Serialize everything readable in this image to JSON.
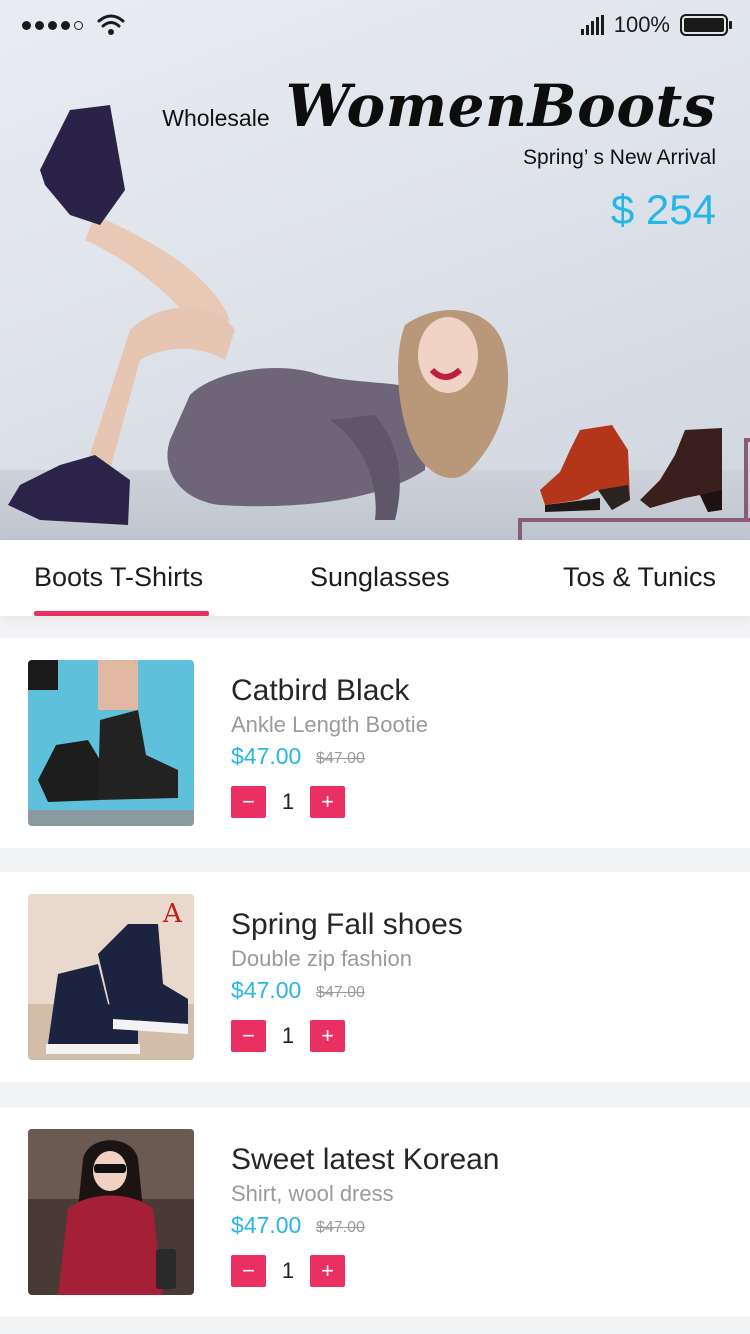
{
  "status_bar": {
    "battery_percent": "100%",
    "battery_level": 1.0,
    "signal_icon": "signal-dots-icon",
    "wifi_icon": "wifi-icon",
    "cell_icon": "cellular-bars-icon",
    "battery_icon": "battery-icon"
  },
  "hero": {
    "prefix": "Wholesale",
    "title": "WomenBoots",
    "subtitle": "Spring’ s New Arrival",
    "price": "$ 254",
    "accent_color": "#25b6e8"
  },
  "tabs": [
    {
      "label": "Boots T-Shirts",
      "active": true
    },
    {
      "label": "Sunglasses",
      "active": false
    },
    {
      "label": "Tos & Tunics",
      "active": false
    }
  ],
  "products": [
    {
      "name": "Catbird Black",
      "description": "Ankle Length Bootie",
      "price": "$47.00",
      "old_price": "$47.00",
      "quantity": "1",
      "minus": "−",
      "plus": "+"
    },
    {
      "name": "Spring Fall shoes",
      "description": "Double zip fashion",
      "price": "$47.00",
      "old_price": "$47.00",
      "quantity": "1",
      "minus": "−",
      "plus": "+"
    },
    {
      "name": "Sweet latest Korean",
      "description": "Shirt, wool dress",
      "price": "$47.00",
      "old_price": "$47.00",
      "quantity": "1",
      "minus": "−",
      "plus": "+"
    }
  ],
  "colors": {
    "accent_pink": "#ea2f62",
    "price_blue": "#29b5e6",
    "background": "#f2f3f5"
  }
}
